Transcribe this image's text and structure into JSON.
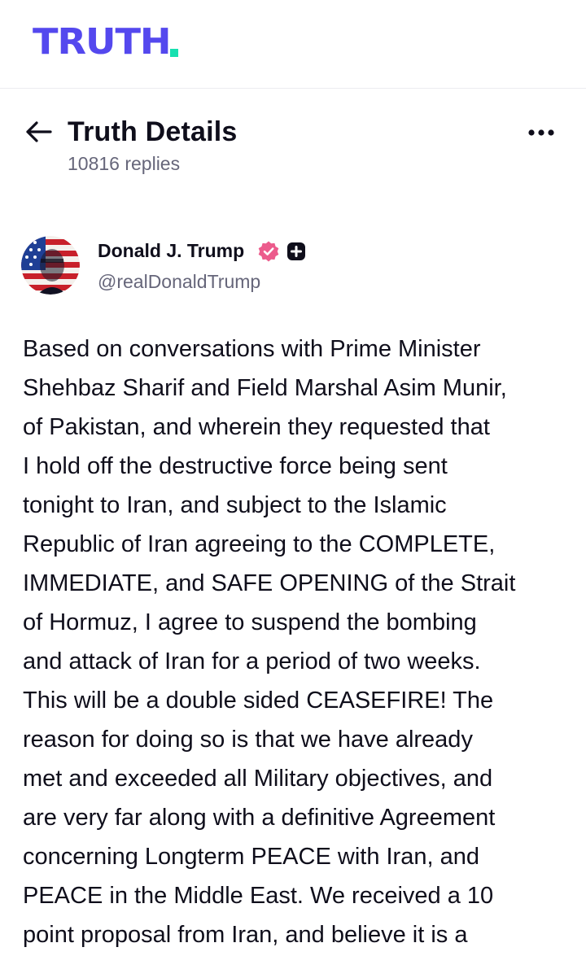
{
  "brand": {
    "name": "TRUTH",
    "text_color": "#5448ee",
    "dot_color": "#17e0b0"
  },
  "header": {
    "title": "Truth Details",
    "reply_count": "10816 replies",
    "back_icon": "arrow-left-icon",
    "more_icon": "more-horizontal-icon"
  },
  "post": {
    "author": {
      "display_name": "Donald J. Trump",
      "handle": "@realDonaldTrump",
      "verified_color": "#ec5b8c",
      "badge_color": "#0f0e1b"
    },
    "lines": [
      "Based on conversations with Prime Minister",
      "Shehbaz Sharif and Field Marshal Asim Munir,",
      "of Pakistan, and wherein they requested that",
      "I hold off the destructive force being sent",
      "tonight to Iran, and subject to the Islamic",
      "Republic of Iran agreeing to the COMPLETE,",
      "IMMEDIATE, and SAFE OPENING of the Strait",
      "of Hormuz, I agree to suspend the bombing",
      "and attack of Iran for a period of two weeks.",
      "This will be a double sided CEASEFIRE! The",
      "reason for doing so is that we have already",
      "met and exceeded all Military objectives, and",
      "are very far along with a definitive Agreement",
      "concerning Longterm PEACE with Iran, and",
      "PEACE in the Middle East. We received a 10",
      "point proposal from Iran, and believe it is a"
    ]
  },
  "colors": {
    "text": "#0f0e1b",
    "muted": "#66667a",
    "divider": "#ececf0"
  }
}
